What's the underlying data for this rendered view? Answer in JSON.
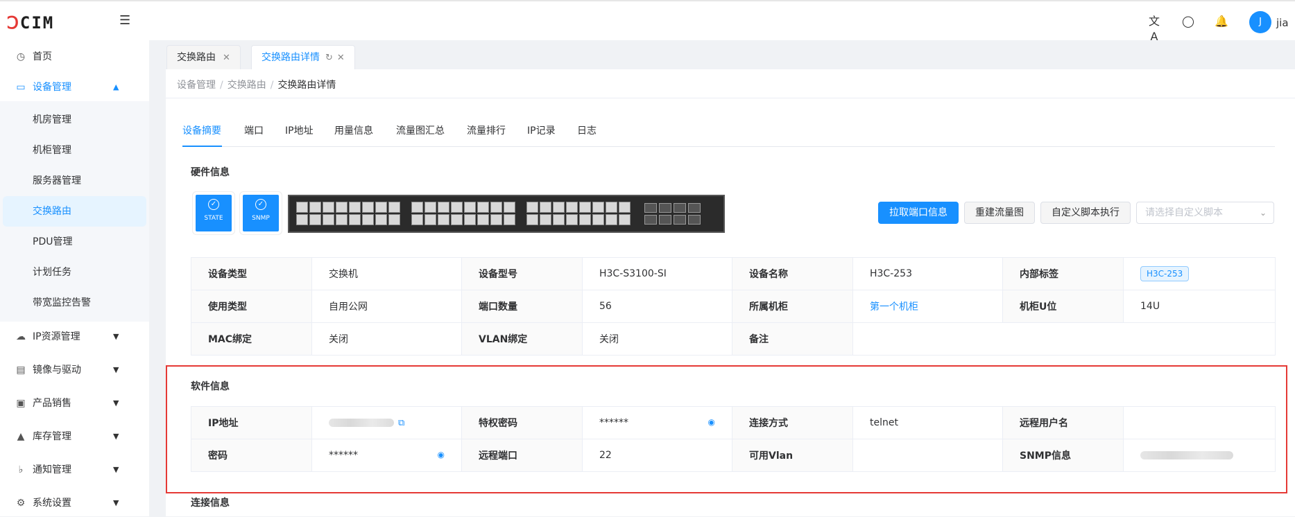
{
  "app": {
    "logo_text": "CIM",
    "logo_mark": "Ↄ"
  },
  "topbar": {
    "username": "jia",
    "avatar_letter": "J"
  },
  "sidebar": {
    "items": [
      {
        "label": "首页",
        "icon": "dashboard-icon"
      },
      {
        "label": "设备管理",
        "icon": "monitor-icon",
        "expanded": true
      },
      {
        "label": "IP资源管理",
        "icon": "cloud-icon"
      },
      {
        "label": "镜像与驱动",
        "icon": "file-icon"
      },
      {
        "label": "产品销售",
        "icon": "bag-icon"
      },
      {
        "label": "库存管理",
        "icon": "bank-icon"
      },
      {
        "label": "通知管理",
        "icon": "bell-icon"
      },
      {
        "label": "系统设置",
        "icon": "gear-icon"
      }
    ],
    "sub_items": [
      "机房管理",
      "机柜管理",
      "服务器管理",
      "交换路由",
      "PDU管理",
      "计划任务",
      "带宽监控告警"
    ],
    "selected_sub": "交换路由"
  },
  "page_tabs": [
    {
      "label": "交换路由"
    },
    {
      "label": "交换路由详情"
    }
  ],
  "breadcrumb": {
    "items": [
      "设备管理",
      "交换路由"
    ],
    "current": "交换路由详情",
    "separator": "/"
  },
  "inner_tabs": [
    "设备摘要",
    "端口",
    "IP地址",
    "用量信息",
    "流量图汇总",
    "流量排行",
    "IP记录",
    "日志"
  ],
  "hardware": {
    "title": "硬件信息",
    "status_tiles": [
      "STATE",
      "SNMP"
    ],
    "buttons": {
      "pull_ports": "拉取端口信息",
      "rebuild_traffic": "重建流量图",
      "custom_script": "自定义脚本执行"
    },
    "script_select_placeholder": "请选择自定义脚本",
    "rows": [
      [
        {
          "k": "设备类型",
          "v": "交换机"
        },
        {
          "k": "设备型号",
          "v": "H3C-S3100-SI"
        },
        {
          "k": "设备名称",
          "v": "H3C-253"
        },
        {
          "k": "内部标签",
          "v": "H3C-253"
        }
      ],
      [
        {
          "k": "使用类型",
          "v": "自用公网"
        },
        {
          "k": "端口数量",
          "v": "56"
        },
        {
          "k": "所属机柜",
          "v": "第一个机柜"
        },
        {
          "k": "机柜U位",
          "v": "14U"
        }
      ],
      [
        {
          "k": "MAC绑定",
          "v": "关闭"
        },
        {
          "k": "VLAN绑定",
          "v": "关闭"
        },
        {
          "k": "备注",
          "v": ""
        }
      ]
    ]
  },
  "software": {
    "title": "软件信息",
    "rows": [
      [
        {
          "k": "IP地址",
          "v": ""
        },
        {
          "k": "特权密码",
          "v": "******"
        },
        {
          "k": "连接方式",
          "v": "telnet"
        },
        {
          "k": "远程用户名",
          "v": ""
        }
      ],
      [
        {
          "k": "密码",
          "v": "******"
        },
        {
          "k": "远程端口",
          "v": "22"
        },
        {
          "k": "可用Vlan",
          "v": ""
        },
        {
          "k": "SNMP信息",
          "v": ""
        }
      ]
    ]
  },
  "connection": {
    "title": "连接信息"
  }
}
